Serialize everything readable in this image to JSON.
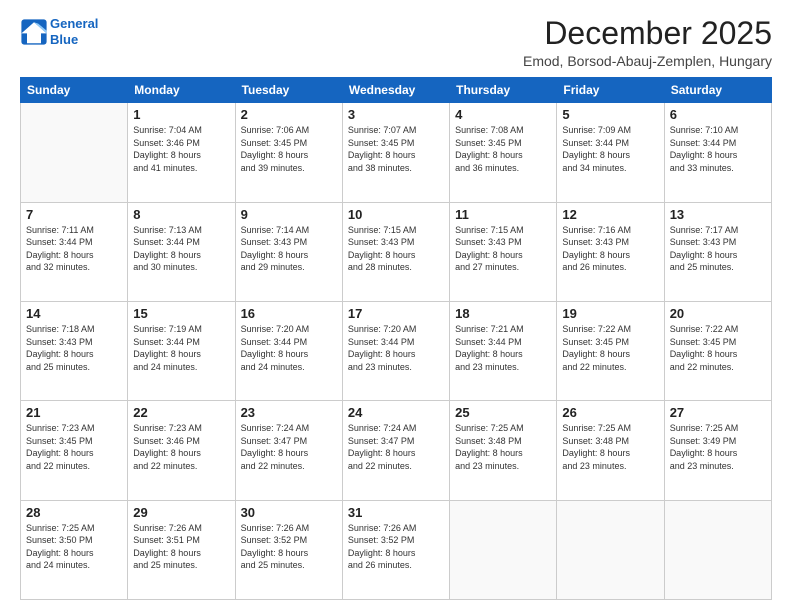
{
  "header": {
    "logo_line1": "General",
    "logo_line2": "Blue",
    "month": "December 2025",
    "location": "Emod, Borsod-Abauj-Zemplen, Hungary"
  },
  "days_of_week": [
    "Sunday",
    "Monday",
    "Tuesday",
    "Wednesday",
    "Thursday",
    "Friday",
    "Saturday"
  ],
  "weeks": [
    [
      {
        "day": "",
        "info": ""
      },
      {
        "day": "1",
        "info": "Sunrise: 7:04 AM\nSunset: 3:46 PM\nDaylight: 8 hours\nand 41 minutes."
      },
      {
        "day": "2",
        "info": "Sunrise: 7:06 AM\nSunset: 3:45 PM\nDaylight: 8 hours\nand 39 minutes."
      },
      {
        "day": "3",
        "info": "Sunrise: 7:07 AM\nSunset: 3:45 PM\nDaylight: 8 hours\nand 38 minutes."
      },
      {
        "day": "4",
        "info": "Sunrise: 7:08 AM\nSunset: 3:45 PM\nDaylight: 8 hours\nand 36 minutes."
      },
      {
        "day": "5",
        "info": "Sunrise: 7:09 AM\nSunset: 3:44 PM\nDaylight: 8 hours\nand 34 minutes."
      },
      {
        "day": "6",
        "info": "Sunrise: 7:10 AM\nSunset: 3:44 PM\nDaylight: 8 hours\nand 33 minutes."
      }
    ],
    [
      {
        "day": "7",
        "info": "Sunrise: 7:11 AM\nSunset: 3:44 PM\nDaylight: 8 hours\nand 32 minutes."
      },
      {
        "day": "8",
        "info": "Sunrise: 7:13 AM\nSunset: 3:44 PM\nDaylight: 8 hours\nand 30 minutes."
      },
      {
        "day": "9",
        "info": "Sunrise: 7:14 AM\nSunset: 3:43 PM\nDaylight: 8 hours\nand 29 minutes."
      },
      {
        "day": "10",
        "info": "Sunrise: 7:15 AM\nSunset: 3:43 PM\nDaylight: 8 hours\nand 28 minutes."
      },
      {
        "day": "11",
        "info": "Sunrise: 7:15 AM\nSunset: 3:43 PM\nDaylight: 8 hours\nand 27 minutes."
      },
      {
        "day": "12",
        "info": "Sunrise: 7:16 AM\nSunset: 3:43 PM\nDaylight: 8 hours\nand 26 minutes."
      },
      {
        "day": "13",
        "info": "Sunrise: 7:17 AM\nSunset: 3:43 PM\nDaylight: 8 hours\nand 25 minutes."
      }
    ],
    [
      {
        "day": "14",
        "info": "Sunrise: 7:18 AM\nSunset: 3:43 PM\nDaylight: 8 hours\nand 25 minutes."
      },
      {
        "day": "15",
        "info": "Sunrise: 7:19 AM\nSunset: 3:44 PM\nDaylight: 8 hours\nand 24 minutes."
      },
      {
        "day": "16",
        "info": "Sunrise: 7:20 AM\nSunset: 3:44 PM\nDaylight: 8 hours\nand 24 minutes."
      },
      {
        "day": "17",
        "info": "Sunrise: 7:20 AM\nSunset: 3:44 PM\nDaylight: 8 hours\nand 23 minutes."
      },
      {
        "day": "18",
        "info": "Sunrise: 7:21 AM\nSunset: 3:44 PM\nDaylight: 8 hours\nand 23 minutes."
      },
      {
        "day": "19",
        "info": "Sunrise: 7:22 AM\nSunset: 3:45 PM\nDaylight: 8 hours\nand 22 minutes."
      },
      {
        "day": "20",
        "info": "Sunrise: 7:22 AM\nSunset: 3:45 PM\nDaylight: 8 hours\nand 22 minutes."
      }
    ],
    [
      {
        "day": "21",
        "info": "Sunrise: 7:23 AM\nSunset: 3:45 PM\nDaylight: 8 hours\nand 22 minutes."
      },
      {
        "day": "22",
        "info": "Sunrise: 7:23 AM\nSunset: 3:46 PM\nDaylight: 8 hours\nand 22 minutes."
      },
      {
        "day": "23",
        "info": "Sunrise: 7:24 AM\nSunset: 3:47 PM\nDaylight: 8 hours\nand 22 minutes."
      },
      {
        "day": "24",
        "info": "Sunrise: 7:24 AM\nSunset: 3:47 PM\nDaylight: 8 hours\nand 22 minutes."
      },
      {
        "day": "25",
        "info": "Sunrise: 7:25 AM\nSunset: 3:48 PM\nDaylight: 8 hours\nand 23 minutes."
      },
      {
        "day": "26",
        "info": "Sunrise: 7:25 AM\nSunset: 3:48 PM\nDaylight: 8 hours\nand 23 minutes."
      },
      {
        "day": "27",
        "info": "Sunrise: 7:25 AM\nSunset: 3:49 PM\nDaylight: 8 hours\nand 23 minutes."
      }
    ],
    [
      {
        "day": "28",
        "info": "Sunrise: 7:25 AM\nSunset: 3:50 PM\nDaylight: 8 hours\nand 24 minutes."
      },
      {
        "day": "29",
        "info": "Sunrise: 7:26 AM\nSunset: 3:51 PM\nDaylight: 8 hours\nand 25 minutes."
      },
      {
        "day": "30",
        "info": "Sunrise: 7:26 AM\nSunset: 3:52 PM\nDaylight: 8 hours\nand 25 minutes."
      },
      {
        "day": "31",
        "info": "Sunrise: 7:26 AM\nSunset: 3:52 PM\nDaylight: 8 hours\nand 26 minutes."
      },
      {
        "day": "",
        "info": ""
      },
      {
        "day": "",
        "info": ""
      },
      {
        "day": "",
        "info": ""
      }
    ]
  ]
}
